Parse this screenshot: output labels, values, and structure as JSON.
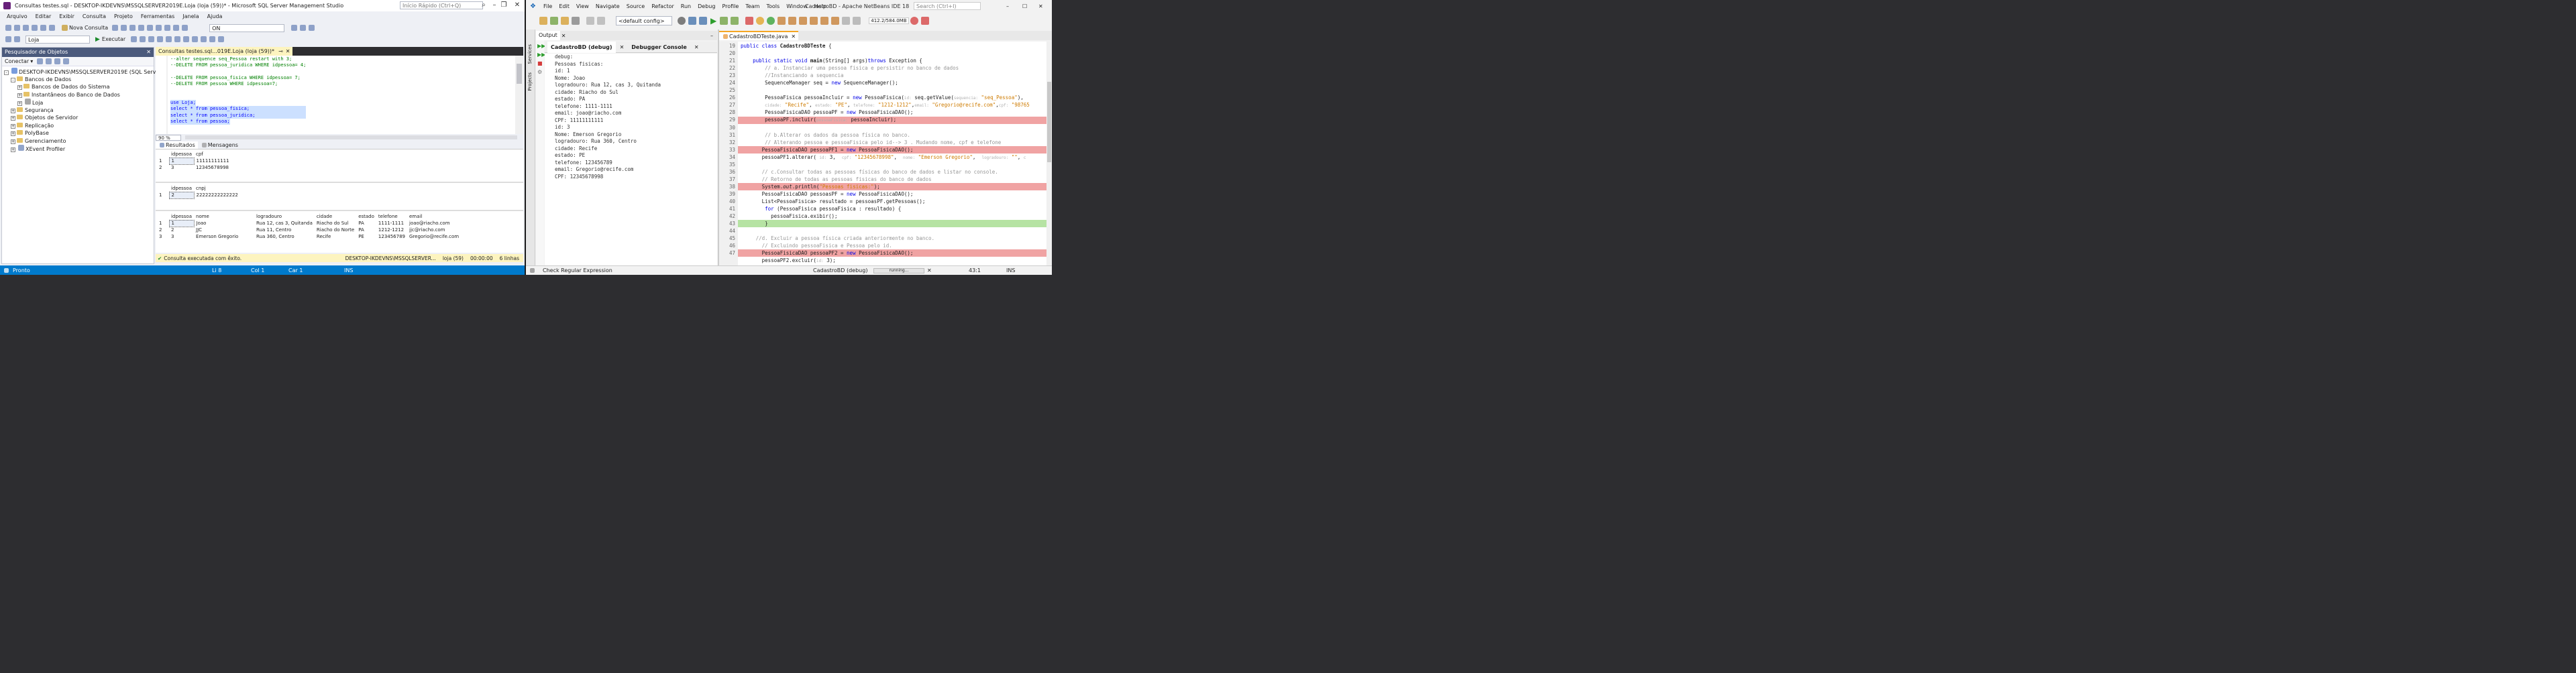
{
  "ssms": {
    "title": "Consultas testes.sql - DESKTOP-IKDEVNS\\MSSQLSERVER2019E.Loja (loja (59))* - Microsoft SQL Server Management Studio",
    "quick_launch": "Início Rápido (Ctrl+Q)",
    "menu": [
      "Arquivo",
      "Editar",
      "Exibir",
      "Consulta",
      "Projeto",
      "Ferramentas",
      "Janela",
      "Ajuda"
    ],
    "new_query": "Nova Consulta",
    "db_combo": "Loja",
    "execute": "Executar",
    "on_combo": "ON",
    "object_explorer": {
      "title": "Pesquisador de Objetos",
      "connect": "Conectar",
      "server": "DESKTOP-IKDEVNS\\MSSQLSERVER2019E (SQL Server 15.0.2101",
      "nodes": [
        "Bancos de Dados",
        "Bancos de Dados do Sistema",
        "Instantâneos do Banco de Dados",
        "Loja",
        "Segurança",
        "Objetos de Servidor",
        "Replicação",
        "PolyBase",
        "Gerenciamento",
        "XEvent Profiler"
      ]
    },
    "tab": "Consultas testes.sql...019E.Loja (loja (59))*",
    "sql": [
      "--alter sequence seq_Pessoa restart with 3;",
      "--DELETE FROM pessoa_juridica WHERE idpessoa= 4;",
      "",
      "--DELETE FROM pessoa_fisica WHERE idpessoa= 7;",
      "--DELETE FROM pessoa WHERE idpessoa=7;",
      "",
      "",
      "use Loja;",
      "select * from pessoa_fisica;",
      "select * from pessoa_juridica;",
      "select * from pessoa;"
    ],
    "zoom": "90 %",
    "results_tab": "Resultados",
    "messages_tab": "Mensagens",
    "grid1": {
      "headers": [
        "idpessoa",
        "cpf"
      ],
      "rows": [
        [
          "1",
          "1",
          "11111111111"
        ],
        [
          "2",
          "3",
          "12345678998"
        ]
      ]
    },
    "grid2": {
      "headers": [
        "idpessoa",
        "cnpj"
      ],
      "rows": [
        [
          "1",
          "2",
          "22222222222222"
        ]
      ]
    },
    "grid3": {
      "headers": [
        "idpessoa",
        "nome",
        "logradouro",
        "cidade",
        "estado",
        "telefone",
        "email"
      ],
      "rows": [
        [
          "1",
          "1",
          "Joao",
          "Rua 12, cas 3, Quitanda",
          "Riacho do Sul",
          "PA",
          "1111-1111",
          "joao@riacho.com"
        ],
        [
          "2",
          "2",
          "JJC",
          "Rua 11, Centro",
          "Riacho do Norte",
          "PA",
          "1212-1212",
          "jjc@riacho.com"
        ],
        [
          "3",
          "3",
          "Emerson Gregorio",
          "Rua 360, Centro",
          "Recife",
          "PE",
          "123456789",
          "Gregorio@recife.com"
        ]
      ]
    },
    "exec_status": "Consulta executada com êxito.",
    "exec_server": "DESKTOP-IKDEVNS\\MSSQLSERVER...",
    "exec_user": "loja (59)",
    "exec_time": "00:00:00",
    "exec_rows": "6 linhas",
    "status": {
      "ready": "Pronto",
      "li": "Li 8",
      "col": "Col 1",
      "car": "Car 1",
      "ins": "INS"
    },
    "colors": {
      "status_bar": "#007acc",
      "tab_active": "#fdf4bf",
      "selection": "#cce0ff"
    }
  },
  "netbeans": {
    "title": "CadastroBD - Apache NetBeans IDE 18",
    "menu": [
      "File",
      "Edit",
      "View",
      "Navigate",
      "Source",
      "Refactor",
      "Run",
      "Debug",
      "Profile",
      "Team",
      "Tools",
      "Window",
      "Help"
    ],
    "search": "Search (Ctrl+I)",
    "config": "<default config>",
    "memory": "412.2/584.0MB",
    "side_tabs": [
      "Services",
      "Projects"
    ],
    "output": {
      "title": "Output",
      "tabs": [
        "CadastroBD (debug)",
        "Debugger Console"
      ],
      "lines": [
        "debug:",
        "Pessoas fisicas:",
        "id: 1",
        "Nome: Joao",
        "logradouro: Rua 12, cas 3, Quitanda",
        "cidade: Riacho do Sul",
        "estado: PA",
        "telefone: 1111-1111",
        "email: joao@riacho.com",
        "CPF: 11111111111",
        "id: 3",
        "Nome: Emerson Gregorio",
        "logradouro: Rua 360, Centro",
        "cidade: Recife",
        "estado: PE",
        "telefone: 123456789",
        "email: Gregorio@recife.com",
        "CPF: 12345678998"
      ]
    },
    "editor_tab": "CadastroBDTeste.java",
    "line_numbers": [
      "19",
      "20",
      "21",
      "22",
      "23",
      "24",
      "25",
      "26",
      "27",
      "28",
      "29",
      "30",
      "31",
      "32",
      "33",
      "34",
      "35",
      "36",
      "37",
      "38",
      "39",
      "40",
      "41",
      "42",
      "43",
      "44",
      "45",
      "46",
      "47"
    ],
    "check_regex": "Check Regular Expression",
    "status": {
      "project": "CadastroBD (debug)",
      "state": "running...",
      "pos": "43:1",
      "ins": "INS"
    },
    "colors": {
      "breakpoint": "#f0a3a3",
      "current_line": "#b6e3a3"
    }
  }
}
